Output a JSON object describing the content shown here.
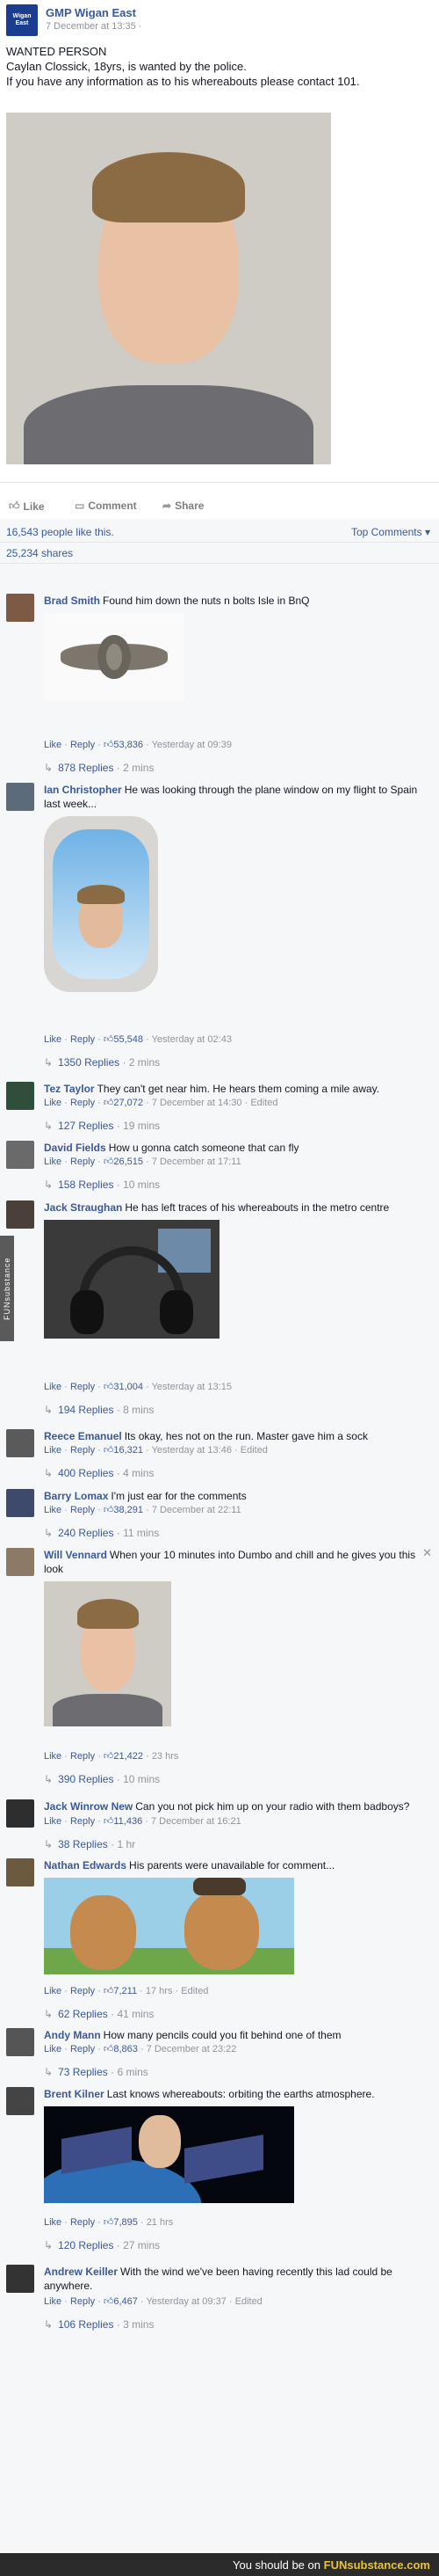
{
  "post": {
    "page_name": "GMP Wigan East",
    "avatar_label": "Wigan East",
    "time": "7 December at 13:35 ·",
    "line1": "WANTED PERSON",
    "line2": "Caylan Clossick, 18yrs, is wanted by the police.",
    "line3": "If you have any information as to his whereabouts please contact 101."
  },
  "actions": {
    "like": "Like",
    "comment": "Comment",
    "share": "Share"
  },
  "summary": {
    "likes": "16,543 people like this.",
    "top_comments": "Top Comments ▾",
    "shares": "25,234 shares"
  },
  "labels": {
    "like": "Like",
    "reply": "Reply"
  },
  "comments": [
    {
      "author": "Brad Smith",
      "text": "Found him down the nuts n bolts Isle in BnQ",
      "likes": "53,836",
      "time": "Yesterday at 09:39",
      "replies": "878 Replies",
      "rtime": "2 mins",
      "edited": ""
    },
    {
      "author": "Ian Christopher",
      "text": "He was looking through the plane window on my flight to Spain last week...",
      "likes": "55,548",
      "time": "Yesterday at 02:43",
      "replies": "1350 Replies",
      "rtime": "2 mins",
      "edited": ""
    },
    {
      "author": "Tez Taylor",
      "text": "They can't get near him. He hears them coming a mile away.",
      "likes": "27,072",
      "time": "7 December at 14:30",
      "replies": "127 Replies",
      "rtime": "19 mins",
      "edited": "Edited"
    },
    {
      "author": "David Fields",
      "text": "How u gonna catch someone that can fly",
      "likes": "26,515",
      "time": "7 December at 17:11",
      "replies": "158 Replies",
      "rtime": "10 mins",
      "edited": ""
    },
    {
      "author": "Jack Straughan",
      "text": "He has left traces of his whereabouts in the metro centre",
      "likes": "31,004",
      "time": "Yesterday at 13:15",
      "replies": "194 Replies",
      "rtime": "8 mins",
      "edited": ""
    },
    {
      "author": "Reece Emanuel",
      "text": "Its okay, hes not on the run. Master gave him a sock",
      "likes": "16,321",
      "time": "Yesterday at 13:46",
      "replies": "400 Replies",
      "rtime": "4 mins",
      "edited": "Edited"
    },
    {
      "author": "Barry Lomax",
      "text": "I'm just ear for the comments",
      "likes": "38,291",
      "time": "7 December at 22:11",
      "replies": "240 Replies",
      "rtime": "11 mins",
      "edited": ""
    },
    {
      "author": "Will Vennard",
      "text": "When your 10 minutes into Dumbo and chill and he gives you this look",
      "likes": "21,422",
      "time": "23 hrs",
      "replies": "390 Replies",
      "rtime": "10 mins",
      "edited": ""
    },
    {
      "author": "Jack Winrow New",
      "text": "Can you not pick him up on your radio with them badboys?",
      "likes": "11,436",
      "time": "7 December at 16:21",
      "replies": "38 Replies",
      "rtime": "1 hr",
      "edited": ""
    },
    {
      "author": "Nathan Edwards",
      "text": "His parents were unavailable for comment...",
      "likes": "7,211",
      "time": "17 hrs",
      "replies": "62 Replies",
      "rtime": "41 mins",
      "edited": "Edited"
    },
    {
      "author": "Andy Mann",
      "text": "How many pencils could you fit behind one of them",
      "likes": "8,863",
      "time": "7 December at 23:22",
      "replies": "73 Replies",
      "rtime": "6 mins",
      "edited": ""
    },
    {
      "author": "Brent Kilner",
      "text": "Last knows whereabouts: orbiting the earths atmosphere.",
      "likes": "7,895",
      "time": "21 hrs",
      "replies": "120 Replies",
      "rtime": "27 mins",
      "edited": ""
    },
    {
      "author": "Andrew Keiller",
      "text": "With the wind we've been having recently this lad could be anywhere.",
      "likes": "6,467",
      "time": "Yesterday at 09:37",
      "replies": "106 Replies",
      "rtime": "3 mins",
      "edited": "Edited"
    }
  ],
  "watermark": "FUNsubstance",
  "footer": {
    "prefix": "You should be on ",
    "brand": "FUNsubstance.com"
  },
  "colors": {
    "link": "#3b5998",
    "muted": "#90949c",
    "ufi_bg": "#f6f7f9"
  }
}
